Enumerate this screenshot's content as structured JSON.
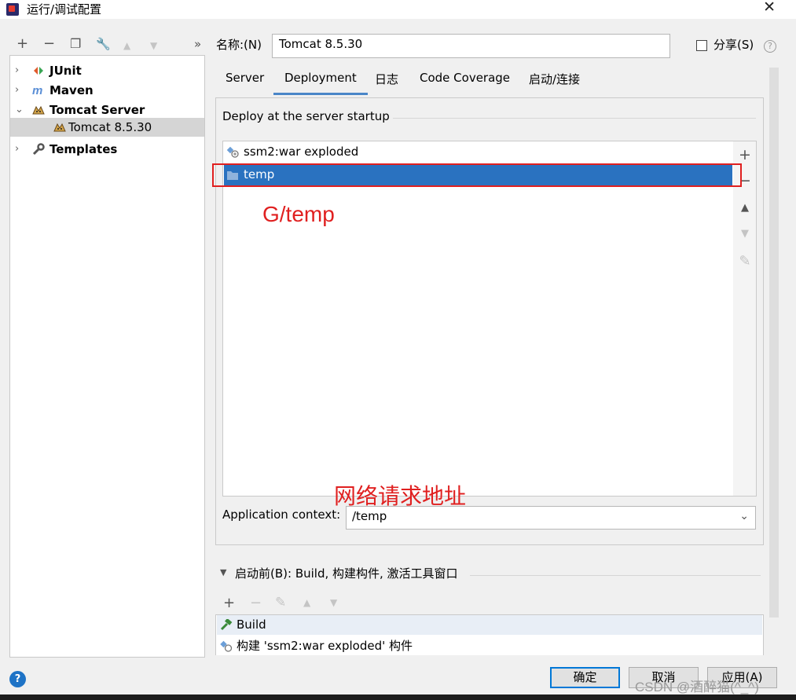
{
  "window": {
    "title": "运行/调试配置",
    "close_glyph": "✕"
  },
  "left_toolbar": {
    "add": "+",
    "remove": "−",
    "copy": "❐",
    "edit": "🔧",
    "up": "▲",
    "down": "▼",
    "more": "»"
  },
  "tree": {
    "items": [
      {
        "label": "JUnit",
        "icon": "junit-icon",
        "expanded": false
      },
      {
        "label": "Maven",
        "icon": "maven-icon",
        "expanded": false
      },
      {
        "label": "Tomcat Server",
        "icon": "tomcat-icon",
        "expanded": true
      },
      {
        "label": "Tomcat 8.5.30",
        "icon": "tomcat-icon",
        "selected": true
      },
      {
        "label": "Templates",
        "icon": "wrench-icon",
        "expanded": false
      }
    ],
    "arrow_collapsed": "›",
    "arrow_expanded": "⌄"
  },
  "name": {
    "label": "名称:(N)",
    "value": "Tomcat 8.5.30"
  },
  "share": {
    "label": "分享(S)",
    "checked": false
  },
  "help_glyph": "?",
  "tabs": [
    {
      "label": "Server",
      "active": false
    },
    {
      "label": "Deployment",
      "active": true
    },
    {
      "label": "日志",
      "active": false
    },
    {
      "label": "Code Coverage",
      "active": false
    },
    {
      "label": "启动/连接",
      "active": false
    }
  ],
  "deployment": {
    "section_title": "Deploy at the server startup",
    "artifacts": [
      {
        "label": "ssm2:war exploded",
        "icon": "artifact-icon",
        "selected": false
      },
      {
        "label": "temp",
        "icon": "folder-icon",
        "selected": true
      }
    ],
    "side_buttons": {
      "add": "+",
      "remove": "−",
      "up": "▲",
      "down": "▼",
      "edit": "✎"
    },
    "app_context_label": "Application context:",
    "app_context_value": "/temp"
  },
  "annotations": {
    "path_note": "G/temp",
    "url_note": "网络请求地址"
  },
  "before_launch": {
    "toggle": "▼",
    "label": "启动前(B): Build, 构建构件, 激活工具窗口",
    "toolbar": {
      "add": "+",
      "remove": "−",
      "edit": "✎",
      "up": "▲",
      "down": "▼"
    },
    "tasks": [
      {
        "label": "Build",
        "icon": "hammer-icon"
      },
      {
        "label": "构建 'ssm2:war exploded' 构件",
        "icon": "artifact-icon"
      }
    ]
  },
  "footer": {
    "ok": "确定",
    "cancel": "取消",
    "apply": "应用(A)",
    "watermark": "CSDN @酒醉猫(^_^)"
  },
  "colors": {
    "selection": "#2a72c0",
    "annotation": "#e02020",
    "tab_underline": "#4a86c8"
  }
}
